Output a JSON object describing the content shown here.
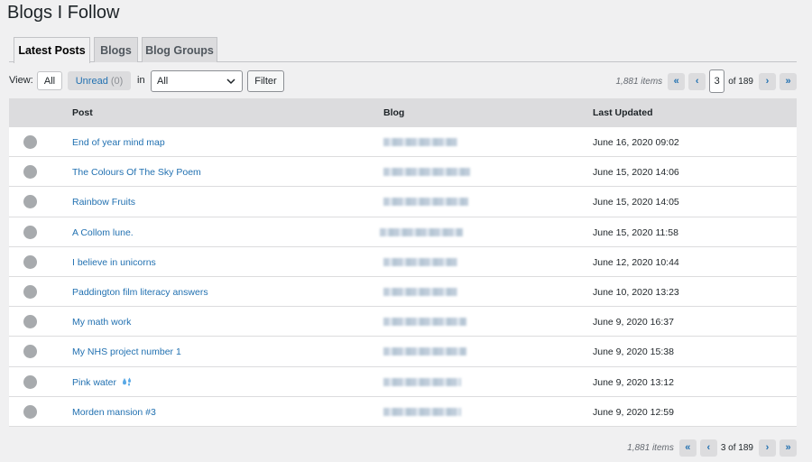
{
  "page": {
    "title": "Blogs I Follow"
  },
  "tabs": [
    {
      "label": "Latest Posts",
      "active": true
    },
    {
      "label": "Blogs",
      "active": false
    },
    {
      "label": "Blog Groups",
      "active": false
    }
  ],
  "filters": {
    "view_label": "View:",
    "all_label": "All",
    "unread_label": "Unread",
    "unread_count": "(0)",
    "in_label": "in",
    "select_value": "All",
    "filter_button": "Filter"
  },
  "pagination": {
    "items": "1,881 items",
    "current_page": "3",
    "of_total": "of 189",
    "bottom_label": "3 of 189",
    "first": "«",
    "prev": "‹",
    "next": "›",
    "last": "»"
  },
  "table": {
    "headers": {
      "post": "Post",
      "blog": "Blog",
      "updated": "Last Updated"
    },
    "rows": [
      {
        "post": "End of year mind map",
        "date": "June 16, 2020 09:02"
      },
      {
        "post": "The Colours Of The Sky Poem",
        "date": "June 15, 2020 14:06"
      },
      {
        "post": "Rainbow Fruits",
        "date": "June 15, 2020 14:05"
      },
      {
        "post": "A Collom lune.",
        "date": "June 15, 2020 11:58"
      },
      {
        "post": "I believe in unicorns",
        "date": "June 12, 2020 10:44"
      },
      {
        "post": "Paddington film literacy answers",
        "date": "June 10, 2020 13:23"
      },
      {
        "post": "My math work",
        "date": "June 9, 2020 16:37"
      },
      {
        "post": "My NHS project number 1",
        "date": "June 9, 2020 15:38"
      },
      {
        "post": "Pink water",
        "date": "June 9, 2020 13:12",
        "icon": "water-droplets-emoji-icon"
      },
      {
        "post": "Morden mansion #3",
        "date": "June 9, 2020 12:59"
      }
    ]
  },
  "colors": {
    "link": "#2271b1",
    "header_bg": "#dcdcde",
    "page_bg": "#f0f0f1",
    "unread_dot": "#a7aaad"
  }
}
